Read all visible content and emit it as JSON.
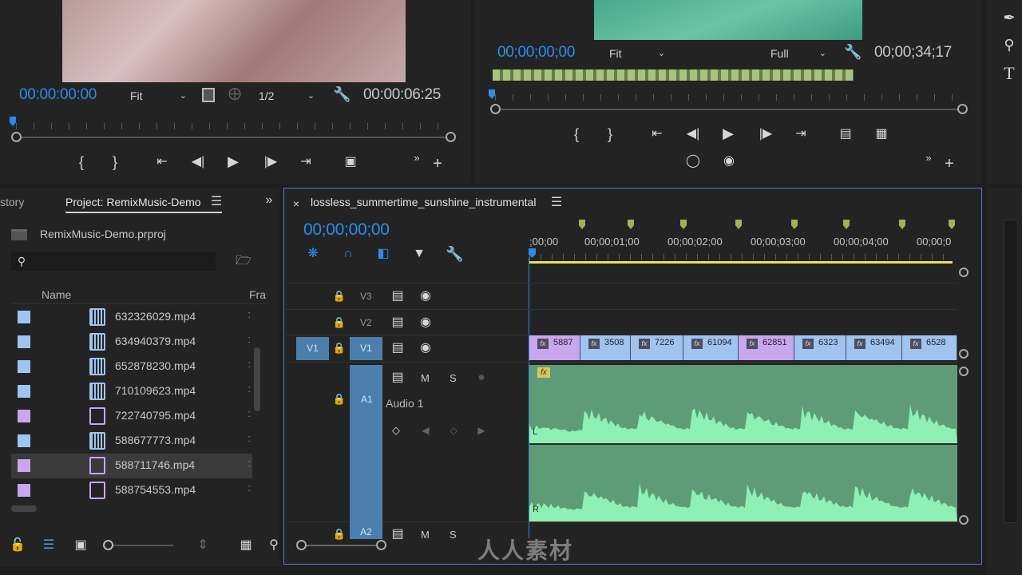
{
  "source_monitor": {
    "timecode_current": "00:00:00:00",
    "fit_select": "Fit",
    "resolution_select": "1/2",
    "timecode_duration": "00:00:06:25"
  },
  "program_monitor": {
    "timecode_current": "00;00;00;00",
    "fit_select": "Fit",
    "quality_select": "Full",
    "timecode_duration": "00;00;34;17"
  },
  "project_panel": {
    "history_tab": "story",
    "project_tab": "Project: RemixMusic-Demo",
    "project_file": "RemixMusic-Demo.prproj",
    "search_placeholder": "",
    "col_name": "Name",
    "col_frame": "Fra",
    "files": [
      {
        "name": "632326029.mp4",
        "color": "#9fc4f0",
        "type": "video"
      },
      {
        "name": "634940379.mp4",
        "color": "#9fc4f0",
        "type": "video"
      },
      {
        "name": "652878230.mp4",
        "color": "#9fc4f0",
        "type": "video"
      },
      {
        "name": "710109623.mp4",
        "color": "#9fc4f0",
        "type": "video"
      },
      {
        "name": "722740795.mp4",
        "color": "#c9a6f0",
        "type": "seq"
      },
      {
        "name": "588677773.mp4",
        "color": "#9fc4f0",
        "type": "video"
      },
      {
        "name": "588711746.mp4",
        "color": "#c9a6f0",
        "type": "seq",
        "selected": true
      },
      {
        "name": "588754553.mp4",
        "color": "#c9a6f0",
        "type": "seq"
      }
    ]
  },
  "timeline": {
    "sequence_tab": "lossless_summertime_sunshine_instrumental",
    "timecode": "00;00;00;00",
    "ruler_labels": [
      ";00;00",
      "00;00;01;00",
      "00;00;02;00",
      "00;00;03;00",
      "00;00;04;00",
      "00;00;0"
    ],
    "tracks": {
      "v3": "V3",
      "v2": "V2",
      "v1": "V1",
      "v1_source": "V1",
      "a1": "A1",
      "a1_name": "Audio 1",
      "a2": "A2",
      "mute": "M",
      "solo": "S",
      "mute2": "M",
      "solo2": "S"
    },
    "clips": [
      {
        "label": "5887",
        "color": "#c9a6f0"
      },
      {
        "label": "3508",
        "color": "#9fc4f0"
      },
      {
        "label": "7226",
        "color": "#9fc4f0"
      },
      {
        "label": "61094",
        "color": "#9fc4f0"
      },
      {
        "label": "62851",
        "color": "#c9a6f0"
      },
      {
        "label": "6323",
        "color": "#9fc4f0"
      },
      {
        "label": "63494",
        "color": "#9fc4f0"
      },
      {
        "label": "6528",
        "color": "#9fc4f0"
      }
    ],
    "audio_fx_badge": "fx",
    "audio_left": "L",
    "audio_right": "R"
  },
  "watermark": "人人素材",
  "colors": {
    "timecode_blue": "#2d8ceb",
    "audio_clip": "#5d9c77",
    "audio_wave": "#8ef0b4",
    "marker": "#9fb35a"
  }
}
